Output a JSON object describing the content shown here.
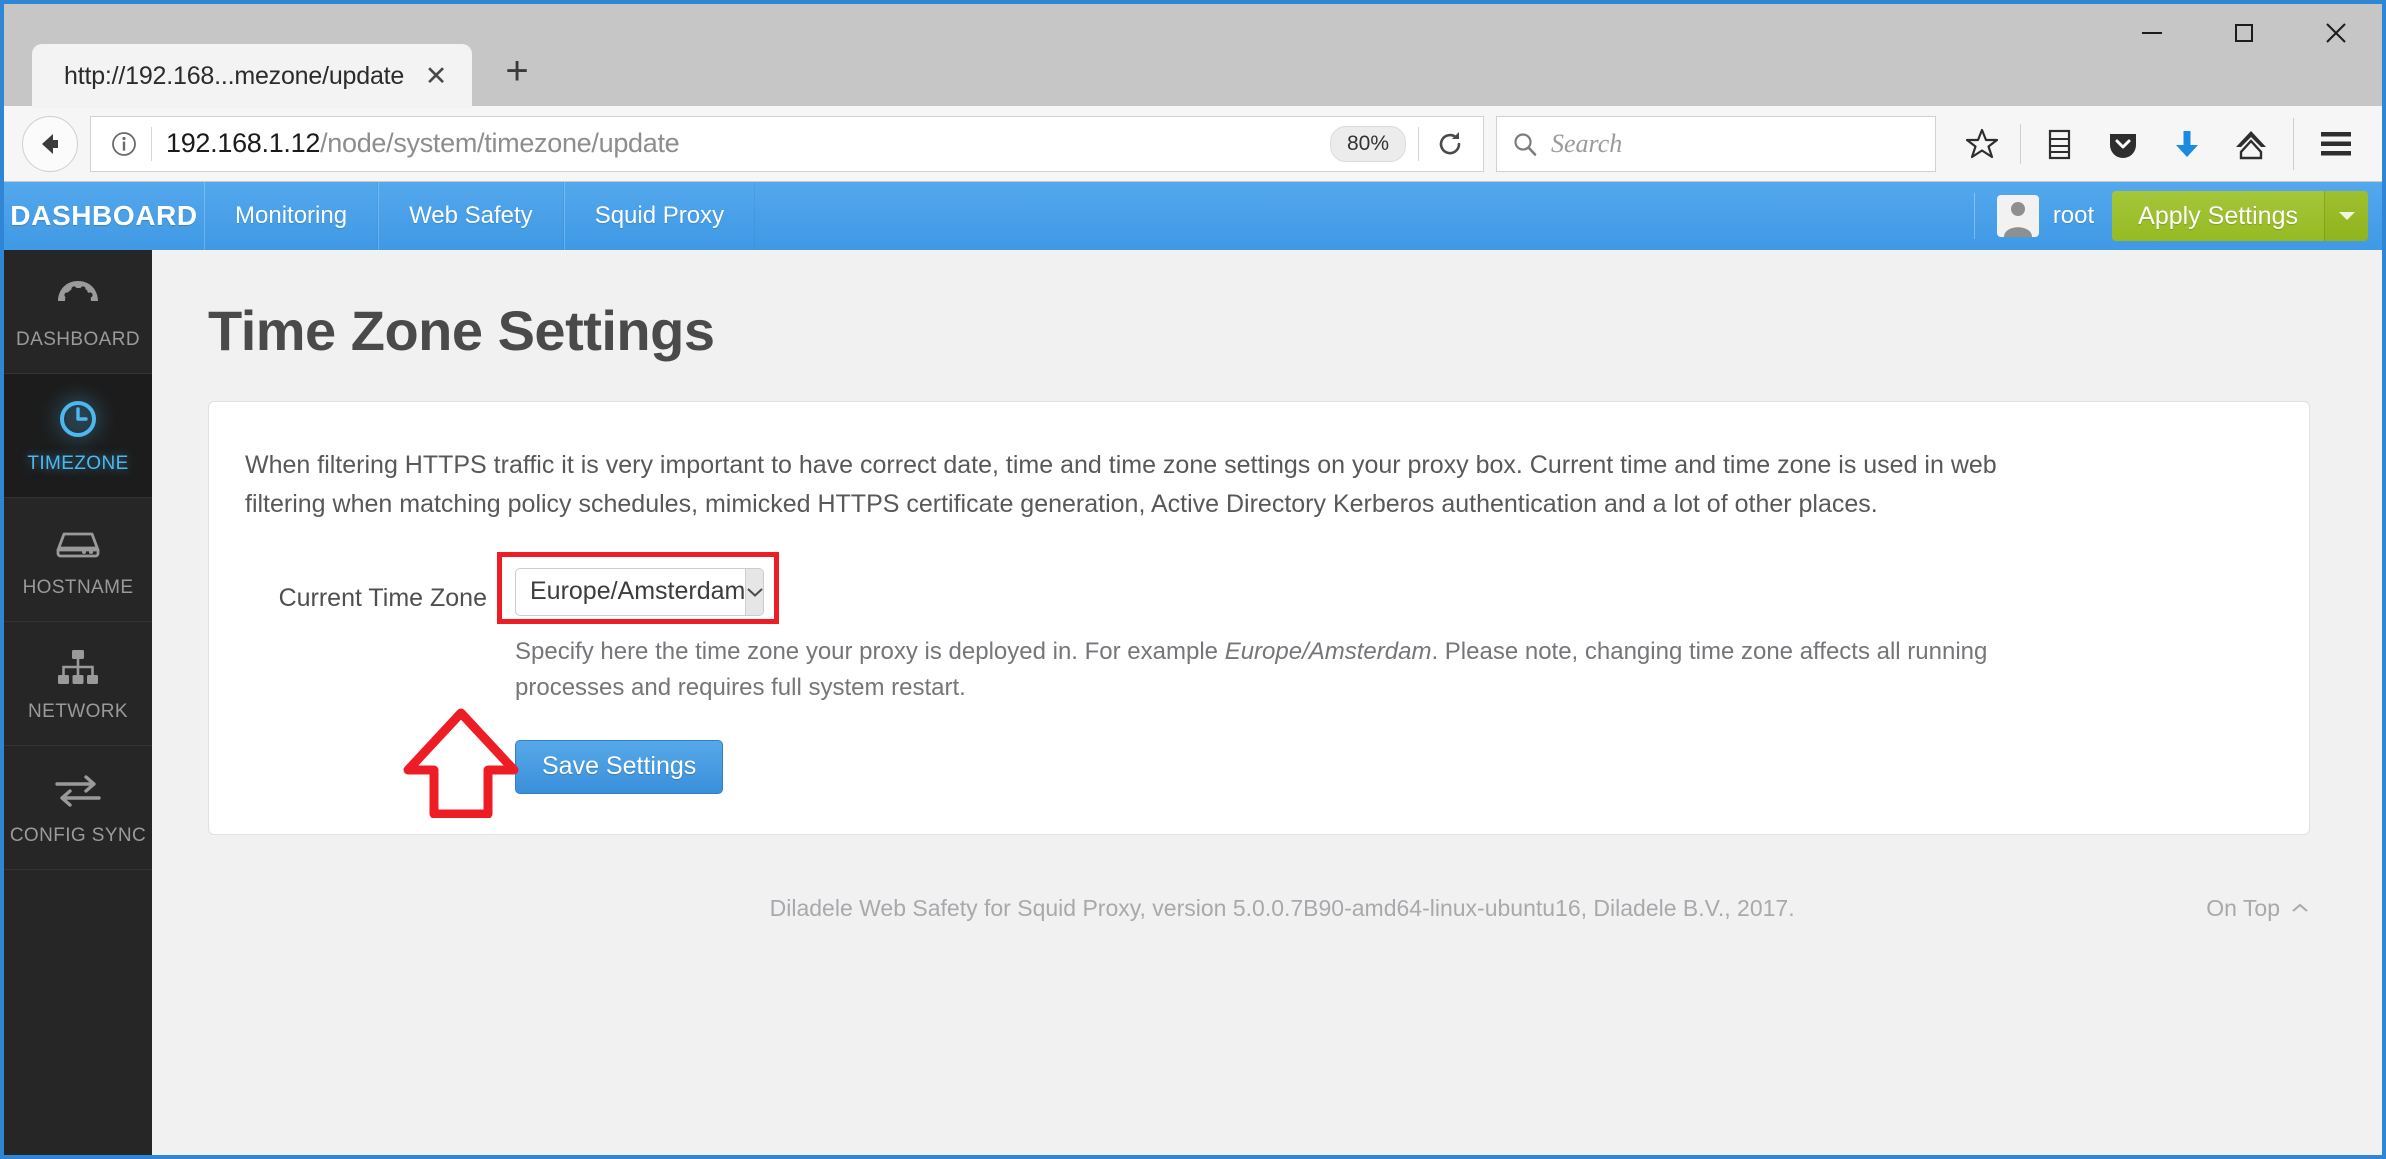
{
  "browser": {
    "tab": {
      "title": "http://192.168...mezone/update",
      "close_label": "✕"
    },
    "new_tab_label": "+",
    "window_controls": {
      "minimize": "minimize-icon",
      "maximize": "maximize-icon",
      "close": "close-icon"
    },
    "url": {
      "host": "192.168.1.12",
      "path": "/node/system/timezone/update"
    },
    "zoom_level": "80%",
    "search": {
      "placeholder": "Search"
    },
    "toolbar_icons": [
      "bookmark-star-icon",
      "reading-list-icon",
      "pocket-icon",
      "downloads-icon",
      "home-icon",
      "menu-icon"
    ]
  },
  "appbar": {
    "brand": "DASHBOARD",
    "nav": [
      {
        "label": "Monitoring"
      },
      {
        "label": "Web Safety"
      },
      {
        "label": "Squid Proxy"
      }
    ],
    "username": "root",
    "apply_button": "Apply Settings",
    "accent_color": "#46a0e8",
    "apply_color": "#9ec02f"
  },
  "sidebar": {
    "active_color": "#4db8ee",
    "items": [
      {
        "label": "DASHBOARD",
        "icon": "gauge-icon",
        "active": false
      },
      {
        "label": "TIMEZONE",
        "icon": "clock-icon",
        "active": true
      },
      {
        "label": "HOSTNAME",
        "icon": "server-icon",
        "active": false
      },
      {
        "label": "NETWORK",
        "icon": "network-icon",
        "active": false
      },
      {
        "label": "CONFIG SYNC",
        "icon": "sync-arrows-icon",
        "active": false
      }
    ]
  },
  "page": {
    "title": "Time Zone Settings",
    "intro": "When filtering HTTPS traffic it is very important to have correct date, time and time zone settings on your proxy box. Current time and time zone is used in web filtering when matching policy schedules, mimicked HTTPS certificate generation, Active Directory Kerberos authentication and a lot of other places.",
    "form": {
      "label": "Current Time Zone",
      "selected_value": "Europe/Amsterdam",
      "help_prefix": "Specify here the time zone your proxy is deployed in. For example ",
      "help_emphasis": "Europe/Amsterdam",
      "help_suffix": ". Please note, changing time zone affects all running processes and requires full system restart."
    },
    "save_button": "Save Settings",
    "annotation_color": "#ee1c24"
  },
  "footer": {
    "text": "Diladele Web Safety for Squid Proxy, version 5.0.0.7B90-amd64-linux-ubuntu16, Diladele B.V., 2017.",
    "on_top": "On Top"
  }
}
